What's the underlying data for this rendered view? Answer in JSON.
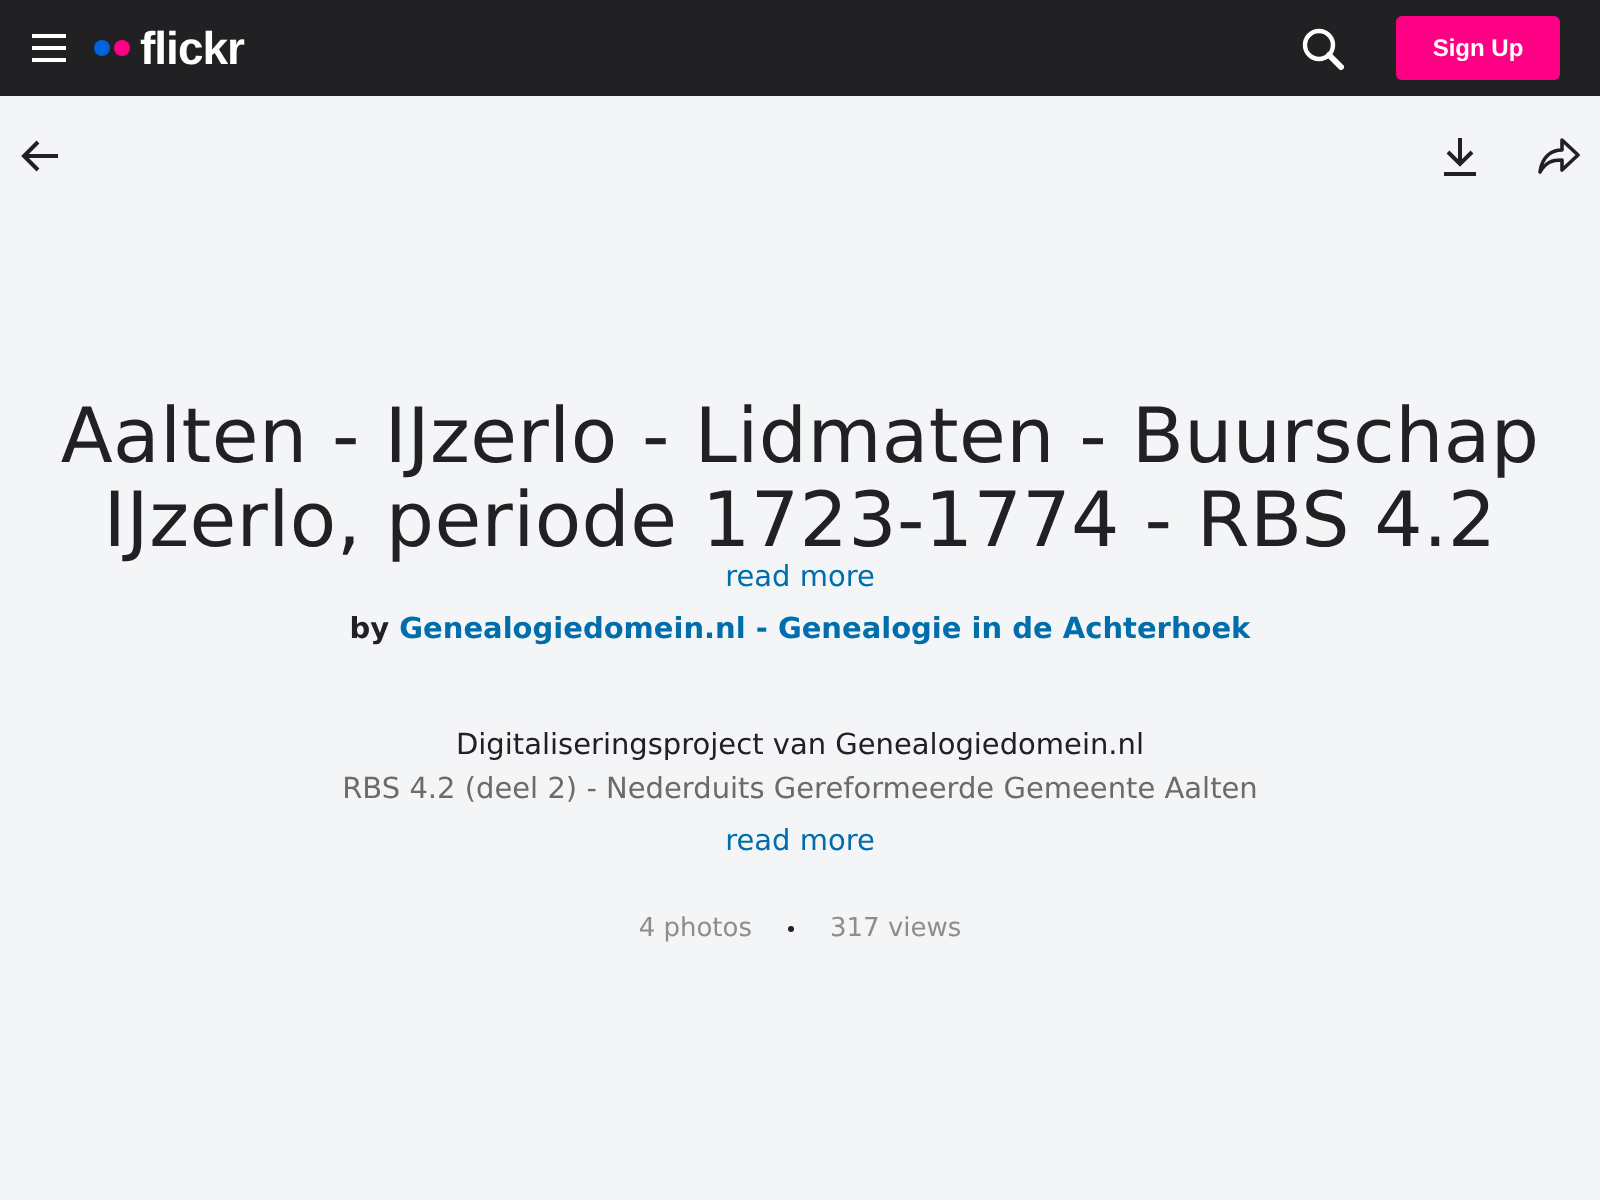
{
  "header": {
    "logo": "flickr",
    "signup": "Sign Up"
  },
  "album": {
    "title": "Aalten - IJzerlo - Lidmaten - Buurschap IJzerlo, periode 1723-1774 - RBS 4.2",
    "title_more": "read more",
    "by": "by",
    "author": "Genealogiedomein.nl - Genealogie in de Achterhoek",
    "description": [
      "Digitaliseringsproject van Genealogiedomein.nl",
      "RBS 4.2 (deel 2) - Nederduits Gereformeerde Gemeente Aalten"
    ],
    "description_more": "read more",
    "stats": [
      "4 photos",
      "317 views"
    ]
  }
}
